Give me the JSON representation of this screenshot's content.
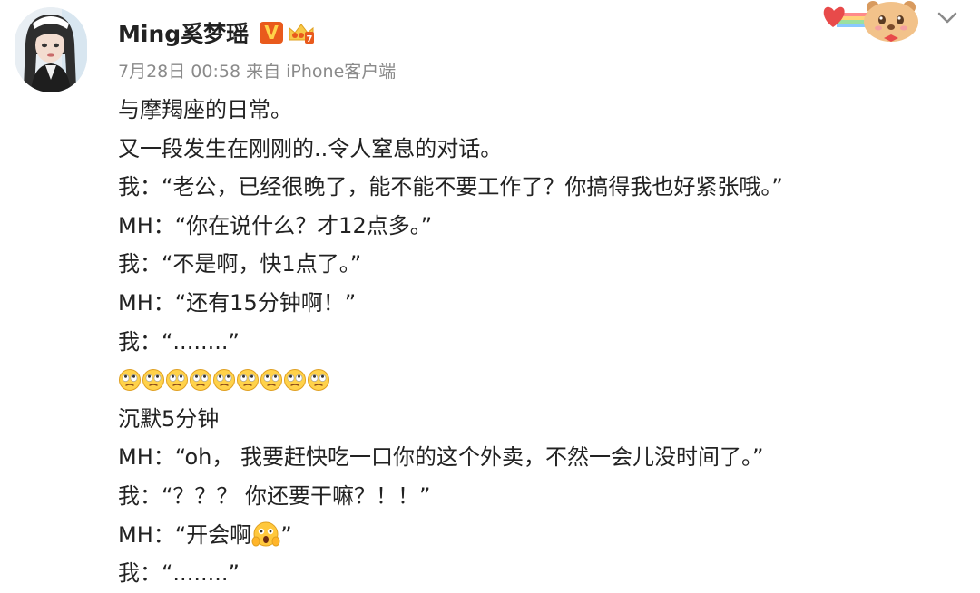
{
  "post": {
    "author": "Ming奚梦瑶",
    "meta": "7月28日 00:58 来自 iPhone客户端",
    "verified_badge": "V",
    "lines": {
      "l1": "与摩羯座的日常。",
      "l2": "又一段发生在刚刚的..令人窒息的对话。",
      "l3": "我：“老公，已经很晚了，能不能不要工作了？你搞得我也好紧张哦。”",
      "l4": "MH：“你在说什么？才12点多。”",
      "l5": "我：“不是啊，快1点了。”",
      "l6": "MH：“还有15分钟啊！”",
      "l7": "我：“........”",
      "l9": "沉默5分钟",
      "l10": "MH：“oh， 我要赶快吃一口你的这个外卖，不然一会儿没时间了。”",
      "l11": "我：“？？？ 你还要干嘛？！！”",
      "l12_pre": "MH：“开会啊",
      "l12_post": "”",
      "l13": "我：“........”"
    },
    "emoji_row": [
      "eye-roll-emoji",
      "eye-roll-emoji",
      "eye-roll-emoji",
      "eye-roll-emoji",
      "eye-roll-emoji",
      "eye-roll-emoji",
      "eye-roll-emoji",
      "eye-roll-emoji",
      "eye-roll-emoji"
    ],
    "icons": {
      "chevron": "chevron-down-icon",
      "sticker": "bear-heart-sticker",
      "crown": "crown-badge-icon"
    }
  },
  "colors": {
    "text": "#222222",
    "meta": "#8a8a8a",
    "badge": "#e95a1c"
  }
}
